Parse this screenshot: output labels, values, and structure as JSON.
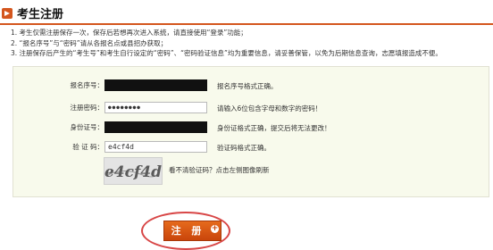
{
  "header": {
    "title": "考生注册"
  },
  "notes": [
    "1.  考生仅需注册保存一次，保存后若想再次进入系统，请直接使用“登录”功能；",
    "2.  “报名序号”与“密码”请从各报名点或县招办获取；",
    "3.  注册保存后产生的“考生号”和考生自行设定的“密码”、“密码验证信息”均为重要信息，请妥善保管，以免为后期信息查询，志愿填报造成不便。"
  ],
  "form": {
    "enroll_no_label": "报名序号：",
    "enroll_no_value": "",
    "enroll_no_hint": "报名序号格式正确。",
    "password_label": "注册密码：",
    "password_value": "●●●●●●●●",
    "password_hint": "请输入6位包含字母和数字的密码！",
    "id_label": "身份证号：",
    "id_value": "",
    "id_hint": "身份证格式正确，提交后将无法更改！",
    "captcha_label": "验 证 码：",
    "captcha_value": "e4cf4d",
    "captcha_hint": "验证码格式正确。",
    "captcha_image_text": "e4cf4d",
    "refresh_hint": "看不清验证码？点击左侧图像刷新"
  },
  "submit": {
    "label": "注 册",
    "icon": "plus-icon"
  },
  "colors": {
    "accent": "#d4561e",
    "form_bg": "#f8faec",
    "highlight_ring": "#d84646"
  }
}
